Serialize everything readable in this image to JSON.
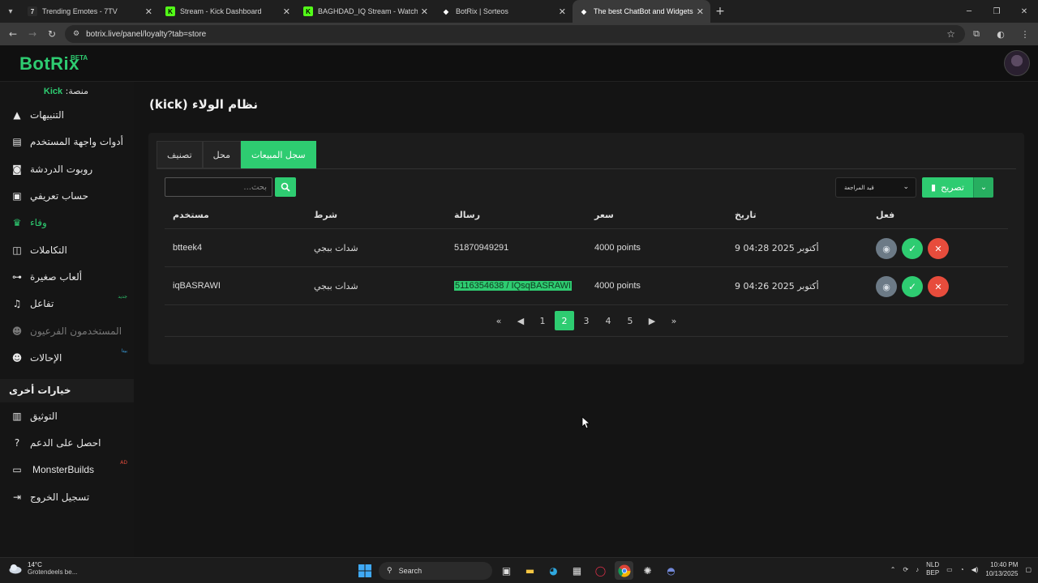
{
  "browser": {
    "tabs": [
      {
        "title": "Trending Emotes - 7TV",
        "active": false
      },
      {
        "title": "Stream - Kick Dashboard",
        "active": false
      },
      {
        "title": "BAGHDAD_IQ Stream - Watch Live",
        "active": false
      },
      {
        "title": "BotRix | Sorteos",
        "active": false
      },
      {
        "title": "The best ChatBot and Widgets",
        "active": true
      }
    ],
    "url": "botrix.live/panel/loyalty?tab=store"
  },
  "header": {
    "logo": "BotRix",
    "beta": "BETA"
  },
  "sidebar": {
    "platform_label": "منصة:",
    "platform_name": "Kick",
    "items": [
      {
        "label": "التنبيهات",
        "icon": "warning-icon"
      },
      {
        "label": "أدوات واجهة المستخدم",
        "icon": "widgets-icon"
      },
      {
        "label": "روبوت الدردشة",
        "icon": "robot-icon"
      },
      {
        "label": "حساب تعريفي",
        "icon": "id-card-icon"
      },
      {
        "label": "وفاء",
        "icon": "trophy-icon",
        "active": true
      },
      {
        "label": "التكاملات",
        "icon": "integrations-icon"
      },
      {
        "label": "ألعاب صغيرة",
        "icon": "gamepad-icon"
      },
      {
        "label": "تفاعل",
        "icon": "music-icon",
        "badge": "جديد"
      },
      {
        "label": "المستخدمون الفرعيون",
        "icon": "users-icon",
        "disabled": true
      },
      {
        "label": "الإحالات",
        "icon": "referrals-icon",
        "badge": "بيتا"
      }
    ],
    "section_title": "خيارات أخرى",
    "other_items": [
      {
        "label": "التوثيق",
        "icon": "book-icon"
      },
      {
        "label": "احصل على الدعم",
        "icon": "help-icon"
      },
      {
        "label": "MonsterBuilds",
        "icon": "laptop-icon",
        "badge": "AD"
      },
      {
        "label": "تسجيل الخروج",
        "icon": "logout-icon"
      }
    ]
  },
  "main": {
    "title": "نظام الولاء (kick)",
    "tabs": [
      "تصنيف",
      "محل",
      "سجل المبيعات"
    ],
    "active_tab": "سجل المبيعات",
    "search_placeholder": "بحث...",
    "filter_value": "قيد المراجعة",
    "export_label": "تصريح",
    "columns": {
      "user": "مستخدم",
      "item": "شرط",
      "message": "رسالة",
      "price": "سعر",
      "date": "تاريخ",
      "action": "فعل"
    },
    "rows": [
      {
        "user": "btteek4",
        "item": "شدات ببجي",
        "message": "51870949291",
        "price": "4000 points",
        "date": "9 أكتوبر 2025 04:28"
      },
      {
        "user": "iqBASRAWI",
        "item": "شدات ببجي",
        "message": "5116354638 / IQsqBASRAWI",
        "price": "4000 points",
        "date": "9 أكتوبر 2025 04:26"
      }
    ],
    "pagination": {
      "pages": [
        "1",
        "2",
        "3",
        "4",
        "5"
      ],
      "current": "2"
    }
  },
  "taskbar": {
    "temp": "14°C",
    "weather": "Grotendeels be...",
    "search": "Search",
    "lang1": "NLD",
    "lang2": "BEP",
    "time": "10:40 PM",
    "date": "10/13/2025"
  },
  "colors": {
    "accent": "#2ecc71",
    "danger": "#e74c3c",
    "muted": "#6c7a86"
  }
}
